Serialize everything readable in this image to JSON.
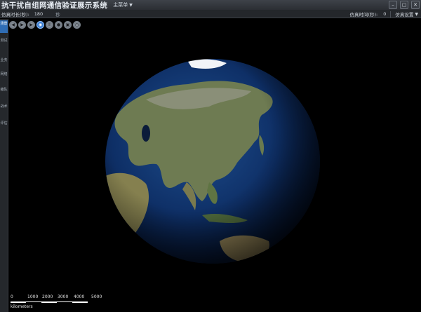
{
  "app": {
    "title": "抗干扰自组网通信验证展示系统",
    "main_menu_label": "主菜单"
  },
  "window_controls": [
    "–",
    "▢",
    "✕"
  ],
  "status": {
    "duration_label": "仿真时长(秒):",
    "duration_value": "180",
    "duration_unit": "秒",
    "sim_time_label": "仿真时间(秒):",
    "sim_time_value": "0",
    "settings_label": "仿真设置"
  },
  "sidebar": {
    "items": [
      {
        "label": "场景",
        "active": true
      },
      {
        "label": "测试",
        "active": false
      },
      {
        "label": "业务",
        "active": false
      },
      {
        "label": "网络",
        "active": false
      },
      {
        "label": "编队",
        "active": false
      },
      {
        "label": "战术",
        "active": false
      },
      {
        "label": "评估",
        "active": false
      }
    ]
  },
  "toolbar": {
    "buttons": [
      {
        "icon": "back-icon",
        "glyph": "◀"
      },
      {
        "icon": "play-icon",
        "glyph": "▶"
      },
      {
        "icon": "forward-icon",
        "glyph": "▶"
      },
      {
        "icon": "globe-view-icon",
        "glyph": "◉"
      },
      {
        "icon": "pause-icon",
        "glyph": "Ⅱ"
      },
      {
        "icon": "record-icon",
        "glyph": "●"
      },
      {
        "icon": "camera-icon",
        "glyph": "▣"
      },
      {
        "icon": "clock-icon",
        "glyph": "◷"
      }
    ]
  },
  "scale_bar": {
    "ticks": [
      "0",
      "1000",
      "2000",
      "3000",
      "4000",
      "5000"
    ],
    "unit": "kilometers"
  },
  "colors": {
    "accent": "#2f6db5",
    "ocean": "#0b2a5e",
    "land": "#6a7a4e"
  }
}
